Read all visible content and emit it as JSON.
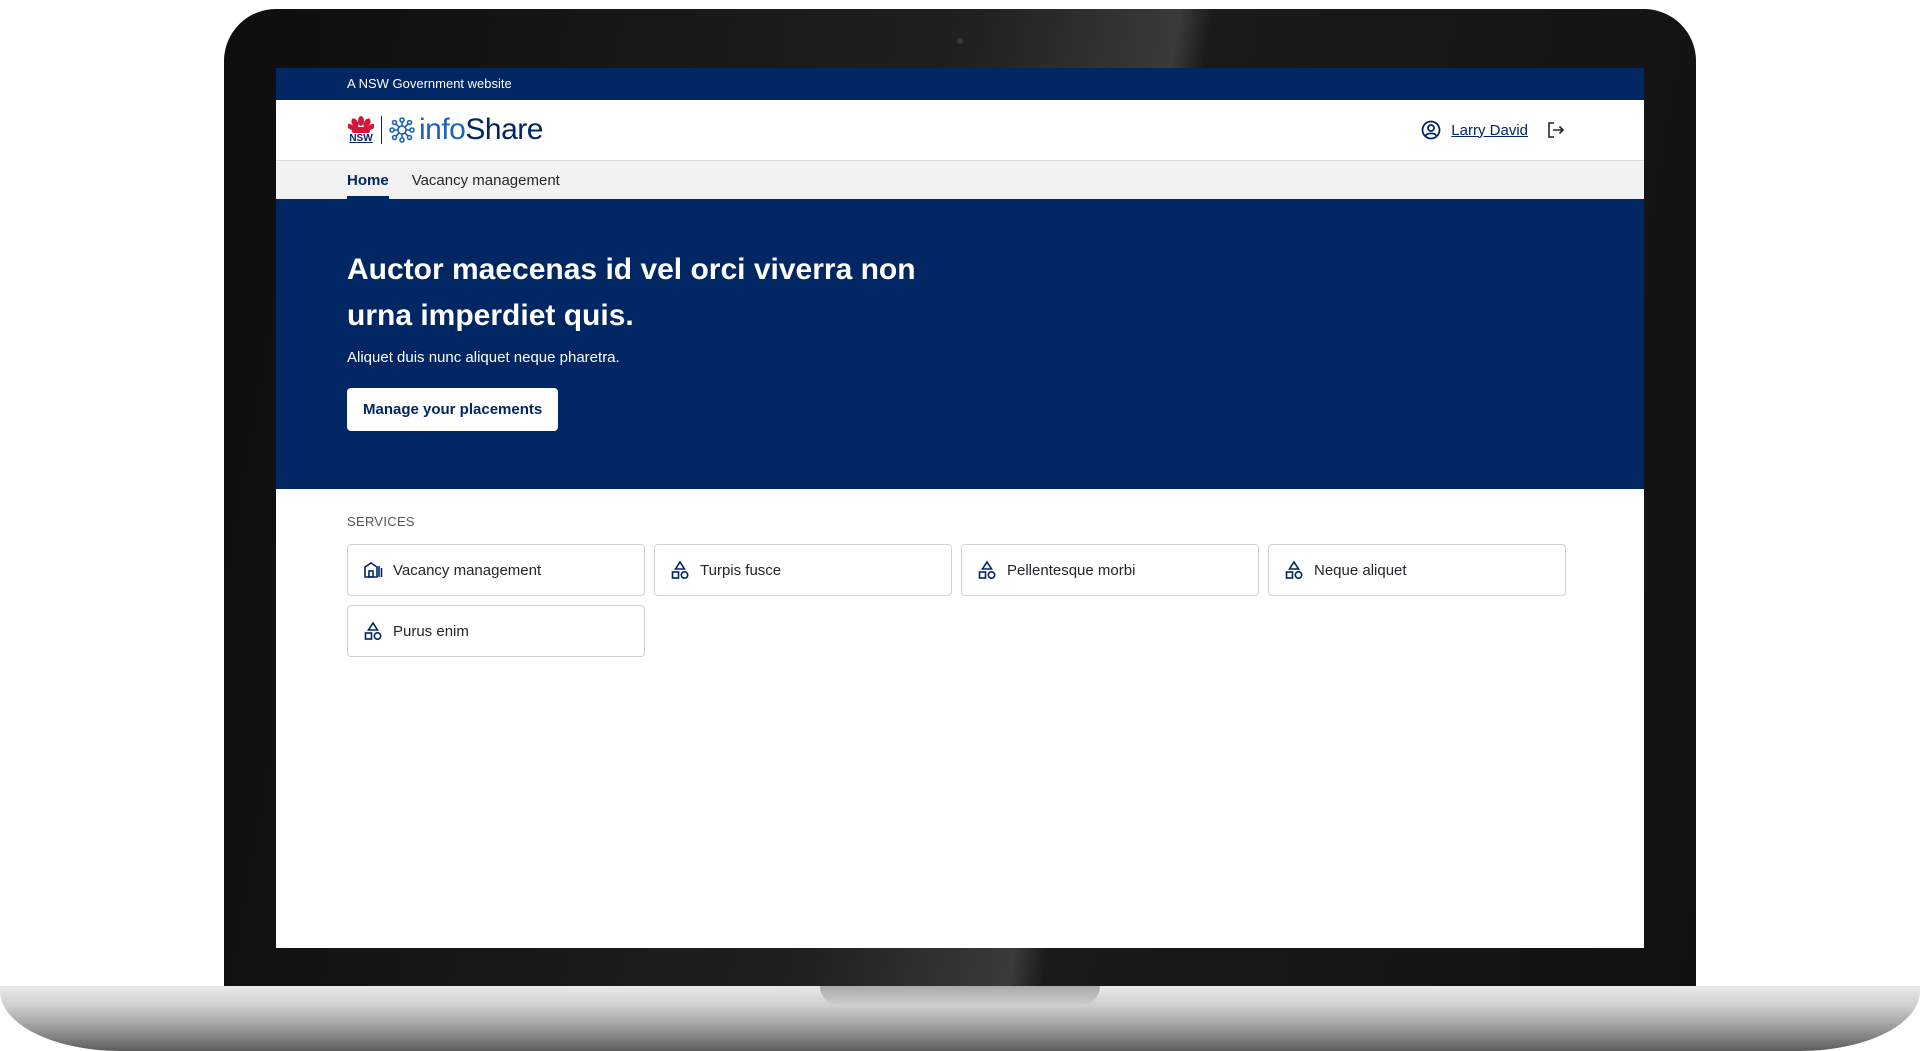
{
  "masthead": {
    "text": "A NSW Government website"
  },
  "header": {
    "logo_text": "NSW",
    "brand_name_prefix": "info",
    "brand_name_suffix": "Share",
    "user_name": "Larry David"
  },
  "nav": {
    "items": [
      {
        "label": "Home",
        "active": true
      },
      {
        "label": "Vacancy management",
        "active": false
      }
    ]
  },
  "hero": {
    "title": "Auctor maecenas id vel orci viverra non urna imperdiet quis.",
    "subtitle": "Aliquet duis nunc aliquet neque pharetra.",
    "button_label": "Manage your placements"
  },
  "services": {
    "label": "SERVICES",
    "items": [
      {
        "label": "Vacancy management",
        "icon": "building-icon"
      },
      {
        "label": "Turpis fusce",
        "icon": "shapes-icon"
      },
      {
        "label": "Pellentesque morbi",
        "icon": "shapes-icon"
      },
      {
        "label": "Neque aliquet",
        "icon": "shapes-icon"
      },
      {
        "label": "Purus enim",
        "icon": "shapes-icon"
      }
    ]
  },
  "colors": {
    "primary": "#002664",
    "accent": "#1c63b7",
    "nsw_red": "#d7153a"
  }
}
